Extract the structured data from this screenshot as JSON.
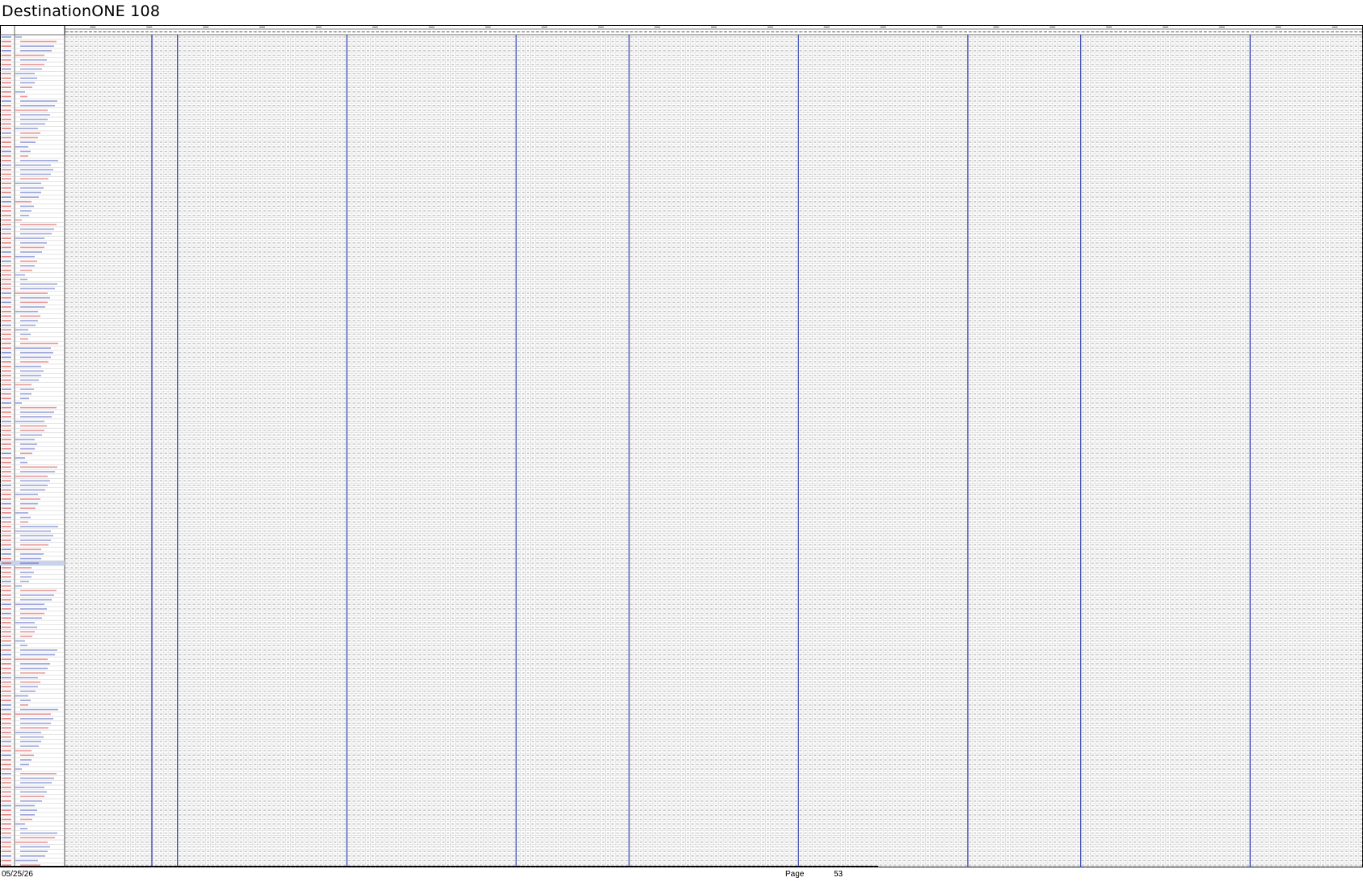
{
  "document": {
    "title": "DestinationONE 108"
  },
  "sheet": {
    "header_left": "",
    "header_name": "",
    "row_count": 182,
    "group_count": 23,
    "section_divider_color": "#2233aa",
    "grid_color": "#bdbdbd",
    "cell_mark_color": "#c7c7c7",
    "red_label_color": "#cc2222",
    "blue_label_color": "#2a3fb0",
    "highlight_row_color": "#c9d3ee"
  },
  "footer": {
    "date": "05/25/26",
    "page_label": "Page",
    "page_number": "53"
  }
}
